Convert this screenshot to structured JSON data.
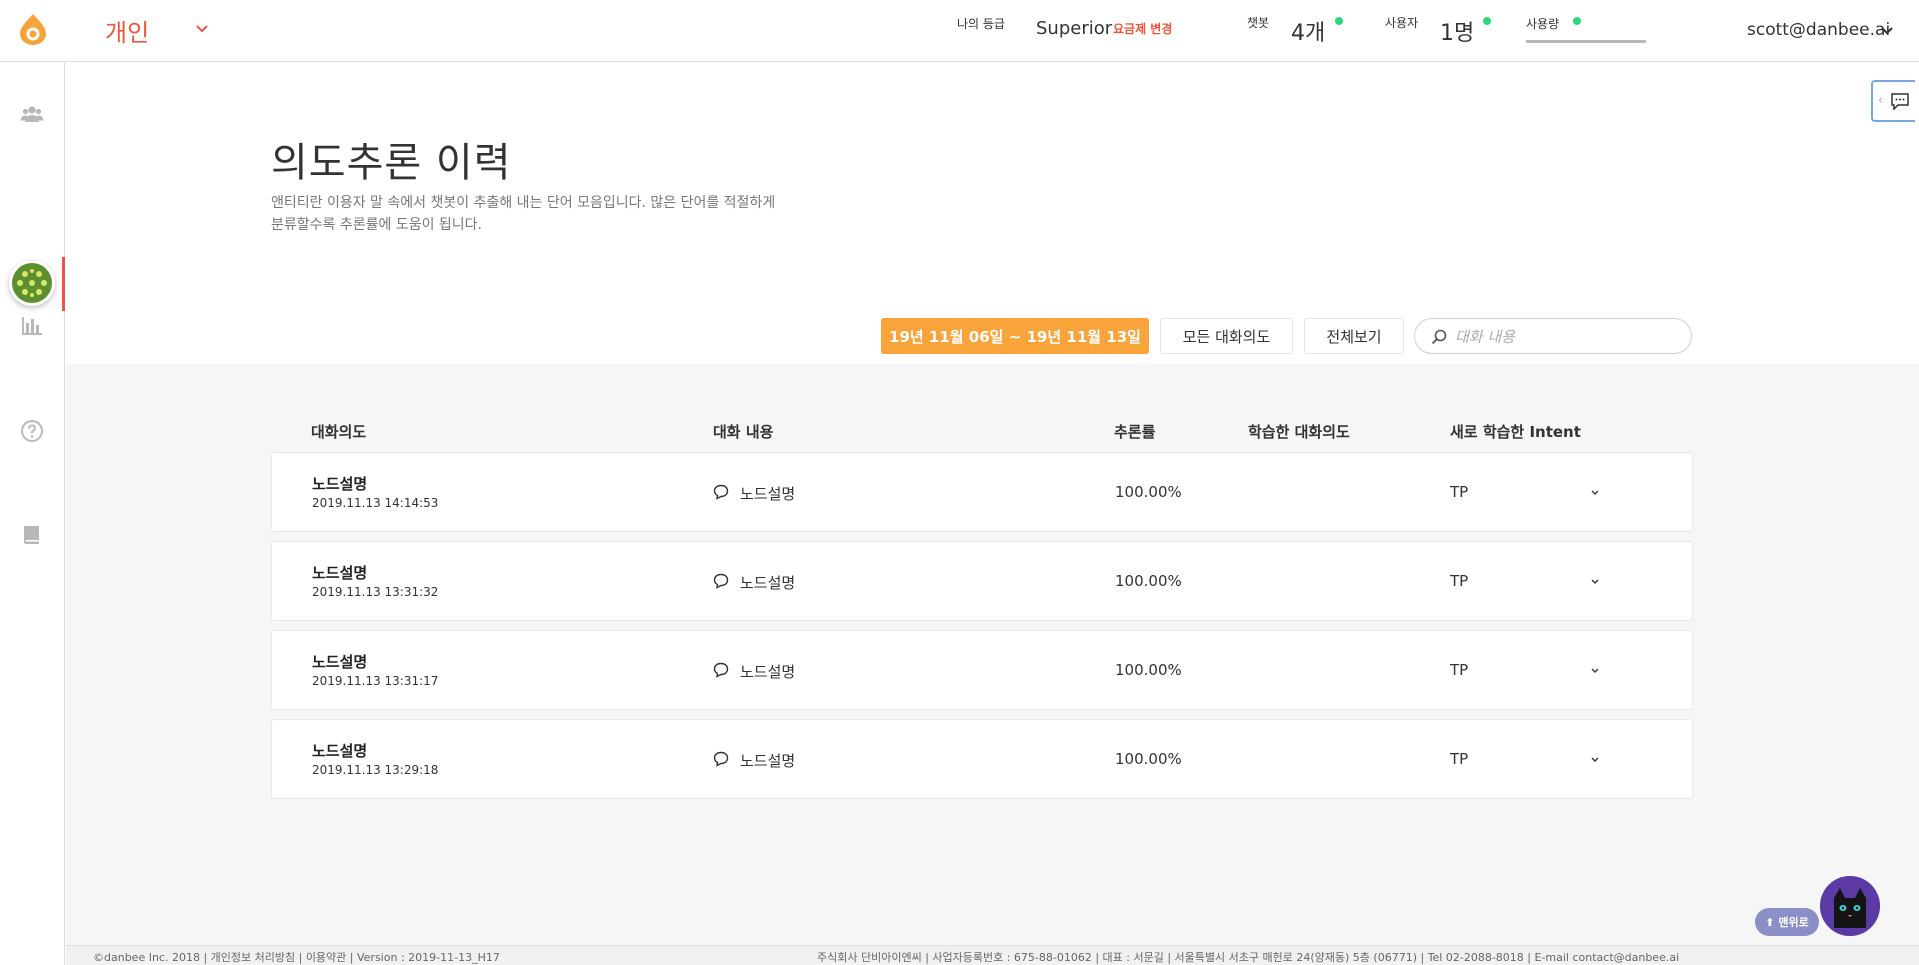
{
  "header": {
    "workspace": "개인",
    "grade_label": "나의 등급",
    "grade_value": "Superior",
    "plan_change": "요금제 변경",
    "chatbot_label": "챗봇",
    "chatbot_value": "4개",
    "users_label": "사용자",
    "users_value": "1명",
    "usage_label": "사용량",
    "account": "scott@danbee.ai"
  },
  "sidebar": {
    "items": [
      "users-icon",
      "avatar",
      "bar-chart-icon",
      "help-icon",
      "book-icon"
    ]
  },
  "page": {
    "title": "의도추론 이력",
    "description_line1": "앤티티란 이용자 말 속에서 챗봇이 추출해 내는 단어 모음입니다. 많은 단어를 적절하게",
    "description_line2": "분류할수록 추론률에 도움이 됩니다."
  },
  "filters": {
    "date_range": "19년 11월 06일 ~ 19년 11월 13일",
    "all_intents": "모든 대화의도",
    "view_all": "전체보기",
    "search_placeholder": "대화 내용"
  },
  "table": {
    "headers": {
      "intent": "대화의도",
      "content": "대화 내용",
      "rate": "추론률",
      "learned": "학습한 대화의도",
      "new_intent": "새로 학습한 Intent"
    },
    "rows": [
      {
        "intent": "노드설명",
        "time": "2019.11.13 14:14:53",
        "content": "노드설명",
        "rate": "100.00%",
        "new_intent": "TP"
      },
      {
        "intent": "노드설명",
        "time": "2019.11.13 13:31:32",
        "content": "노드설명",
        "rate": "100.00%",
        "new_intent": "TP"
      },
      {
        "intent": "노드설명",
        "time": "2019.11.13 13:31:17",
        "content": "노드설명",
        "rate": "100.00%",
        "new_intent": "TP"
      },
      {
        "intent": "노드설명",
        "time": "2019.11.13 13:29:18",
        "content": "노드설명",
        "rate": "100.00%",
        "new_intent": "TP"
      }
    ]
  },
  "footer": {
    "left": "©danbee Inc. 2018 | 개인정보 처리방침 | 이용약관 | Version : 2019-11-13_H17",
    "right": "주식회사 단비아이엔씨 | 사업자등록번호 : 675-88-01062 | 대표 : 서문길 | 서울특별시 서초구 매헌로 24(양재동) 5층 (06771) | Tel 02-2088-8018 | E-mail contact@danbee.ai"
  },
  "widgets": {
    "to_top": "⬆ 맨위로"
  },
  "colors": {
    "accent": "#f0553c",
    "date_button": "#f9a33b",
    "status_dot": "#2fd67b",
    "to_top": "#8a8fc7"
  }
}
